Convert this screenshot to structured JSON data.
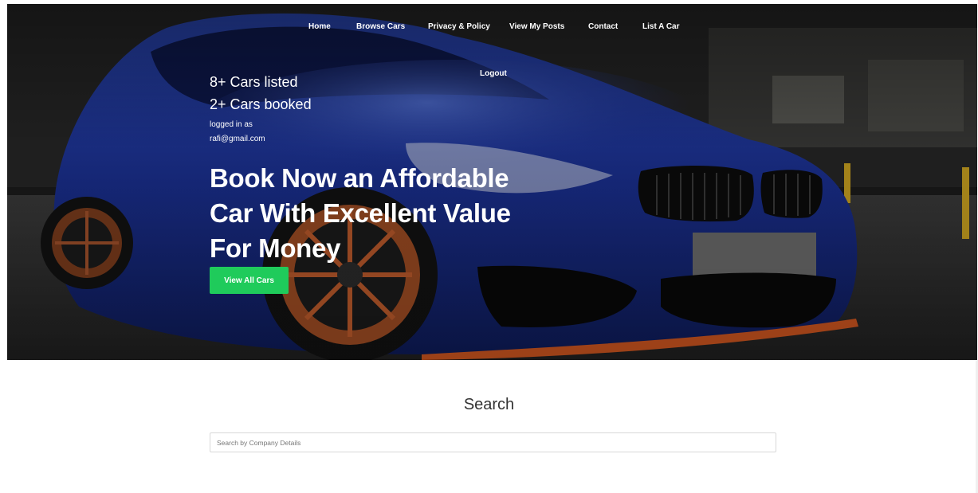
{
  "nav": {
    "items": [
      {
        "label": "Home"
      },
      {
        "label": "Browse Cars"
      },
      {
        "label": "Privacy & Policy"
      },
      {
        "label": "View My Posts"
      },
      {
        "label": "Contact"
      },
      {
        "label": "List A Car"
      }
    ],
    "logout_label": "Logout"
  },
  "hero": {
    "cars_listed": "8+ Cars listed",
    "cars_booked": "2+ Cars booked",
    "logged_in_label": "logged in as",
    "user_email": "rafi@gmail.com",
    "headline_lines": [
      "Book Now an Affordable",
      "Car With Excellent Value",
      "For Money"
    ],
    "cta_label": "View All Cars",
    "accent_color": "#1fcb5b"
  },
  "search": {
    "title": "Search",
    "placeholder": "Search by Company Details",
    "value": ""
  }
}
